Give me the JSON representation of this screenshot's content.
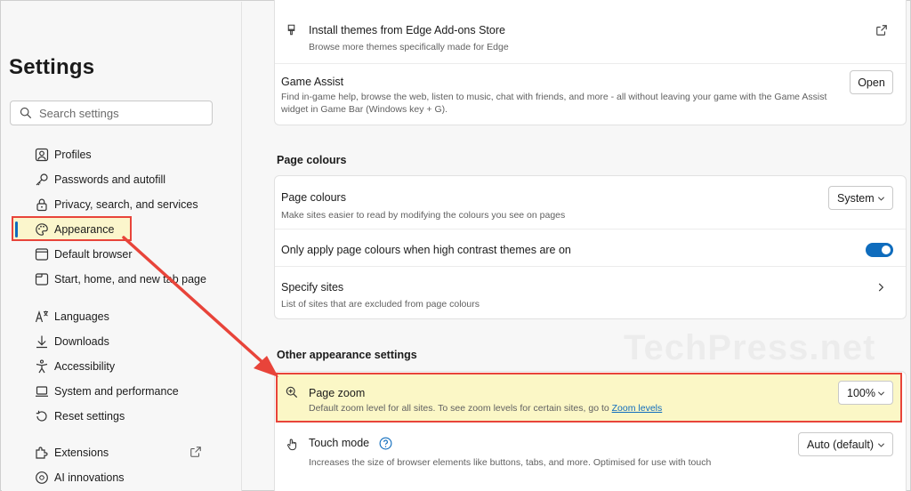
{
  "sidebar": {
    "title": "Settings",
    "search_placeholder": "Search settings",
    "items": [
      {
        "label": "Profiles",
        "icon": "profile-icon"
      },
      {
        "label": "Passwords and autofill",
        "icon": "key-icon"
      },
      {
        "label": "Privacy, search, and services",
        "icon": "lock-icon"
      },
      {
        "label": "Appearance",
        "icon": "palette-icon"
      },
      {
        "label": "Default browser",
        "icon": "browser-icon"
      },
      {
        "label": "Start, home, and new tab page",
        "icon": "home-tab-icon"
      },
      {
        "label": "Languages",
        "icon": "languages-icon"
      },
      {
        "label": "Downloads",
        "icon": "download-icon"
      },
      {
        "label": "Accessibility",
        "icon": "accessibility-icon"
      },
      {
        "label": "System and performance",
        "icon": "laptop-icon"
      },
      {
        "label": "Reset settings",
        "icon": "reset-icon"
      },
      {
        "label": "Extensions",
        "icon": "puzzle-icon"
      },
      {
        "label": "AI innovations",
        "icon": "ai-icon"
      }
    ],
    "active_item": "Appearance"
  },
  "main": {
    "themes_store": {
      "title": "Install themes from Edge Add-ons Store",
      "desc": "Browse more themes specifically made for Edge"
    },
    "game_assist": {
      "title": "Game Assist",
      "desc_line1": "Find in-game help, browse the web, listen to music, chat with friends, and more - all without leaving your game with the Game Assist",
      "desc_line2": "widget in Game Bar (Windows key + G).",
      "button": "Open"
    },
    "page_colours_section": "Page colours",
    "page_colours": {
      "title": "Page colours",
      "desc": "Make sites easier to read by modifying the colours you see on pages",
      "dropdown": "System"
    },
    "high_contrast": {
      "title": "Only apply page colours when high contrast themes are on",
      "enabled": true
    },
    "specify_sites": {
      "title": "Specify sites",
      "desc": "List of sites that are excluded from page colours"
    },
    "other_section": "Other appearance settings",
    "page_zoom": {
      "title": "Page zoom",
      "desc": "Default zoom level for all sites. To see zoom levels for certain sites, go to",
      "link": "Zoom levels",
      "dropdown": "100%"
    },
    "touch_mode": {
      "title": "Touch mode",
      "desc": "Increases the size of browser elements like buttons, tabs, and more. Optimised for use with touch",
      "dropdown": "Auto (default)"
    },
    "watermark": "TechPress.net"
  },
  "colors": {
    "accent": "#0f6cbd",
    "highlight_border": "#e8443a",
    "highlight_fill": "#fbf7c6"
  }
}
